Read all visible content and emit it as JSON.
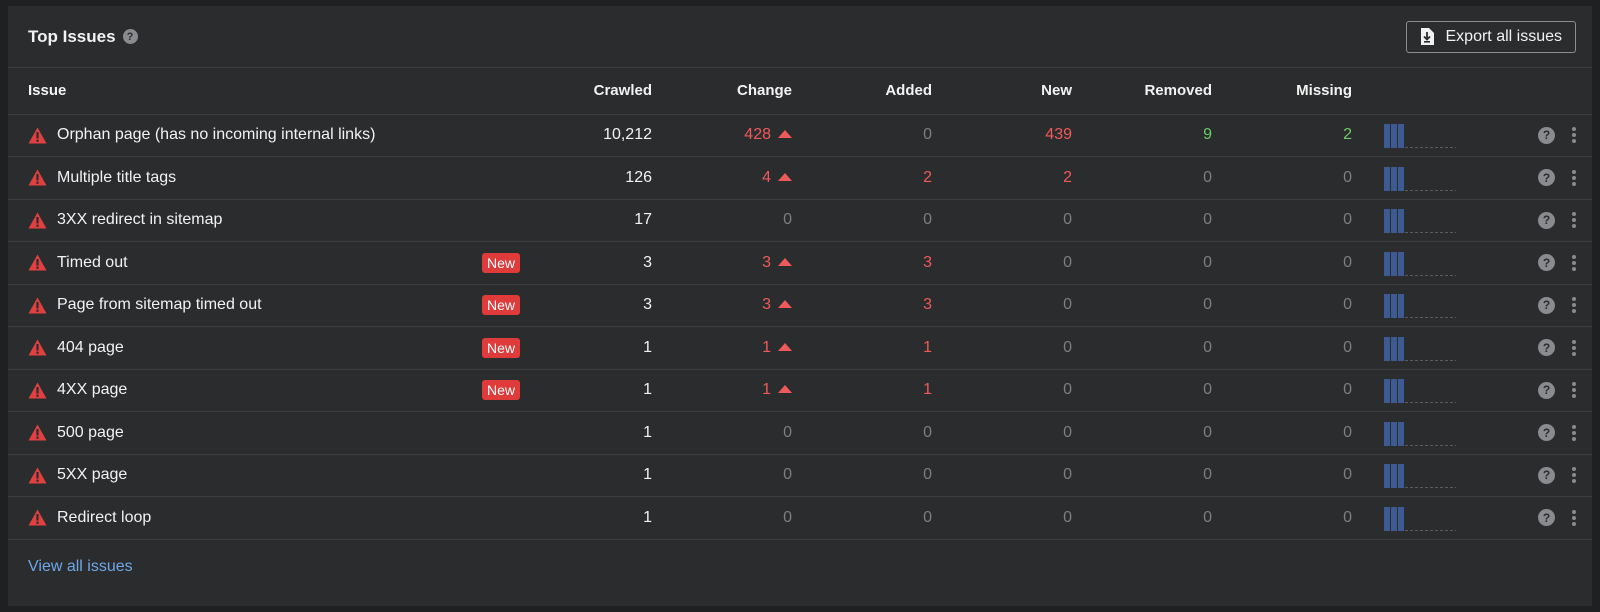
{
  "header": {
    "title": "Top Issues",
    "help_glyph": "?",
    "export_label": "Export all issues"
  },
  "columns": {
    "issue": "Issue",
    "crawled": "Crawled",
    "change": "Change",
    "added": "Added",
    "new": "New",
    "removed": "Removed",
    "missing": "Missing"
  },
  "rows": [
    {
      "name": "Orphan page (has no incoming internal links)",
      "badge": "",
      "crawled": "10,212",
      "change": "428",
      "change_up": true,
      "added": "0",
      "new": "439",
      "removed": "9",
      "missing": "2"
    },
    {
      "name": "Multiple title tags",
      "badge": "",
      "crawled": "126",
      "change": "4",
      "change_up": true,
      "added": "2",
      "new": "2",
      "removed": "0",
      "missing": "0"
    },
    {
      "name": "3XX redirect in sitemap",
      "badge": "",
      "crawled": "17",
      "change": "0",
      "change_up": false,
      "added": "0",
      "new": "0",
      "removed": "0",
      "missing": "0"
    },
    {
      "name": "Timed out",
      "badge": "New",
      "crawled": "3",
      "change": "3",
      "change_up": true,
      "added": "3",
      "new": "0",
      "removed": "0",
      "missing": "0"
    },
    {
      "name": "Page from sitemap timed out",
      "badge": "New",
      "crawled": "3",
      "change": "3",
      "change_up": true,
      "added": "3",
      "new": "0",
      "removed": "0",
      "missing": "0"
    },
    {
      "name": "404 page",
      "badge": "New",
      "crawled": "1",
      "change": "1",
      "change_up": true,
      "added": "1",
      "new": "0",
      "removed": "0",
      "missing": "0"
    },
    {
      "name": "4XX page",
      "badge": "New",
      "crawled": "1",
      "change": "1",
      "change_up": true,
      "added": "1",
      "new": "0",
      "removed": "0",
      "missing": "0"
    },
    {
      "name": "500 page",
      "badge": "",
      "crawled": "1",
      "change": "0",
      "change_up": false,
      "added": "0",
      "new": "0",
      "removed": "0",
      "missing": "0"
    },
    {
      "name": "5XX page",
      "badge": "",
      "crawled": "1",
      "change": "0",
      "change_up": false,
      "added": "0",
      "new": "0",
      "removed": "0",
      "missing": "0"
    },
    {
      "name": "Redirect loop",
      "badge": "",
      "crawled": "1",
      "change": "0",
      "change_up": false,
      "added": "0",
      "new": "0",
      "removed": "0",
      "missing": "0"
    }
  ],
  "icons": {
    "warning": "warning-icon",
    "export": "download-icon",
    "help": "help-icon",
    "menu": "more-vertical-icon",
    "trend": "sparkline-icon"
  },
  "colors": {
    "accent_link": "#6ea7e8",
    "negative": "#ee5a5a",
    "positive": "#69cc69",
    "badge": "#e03b3b",
    "sparkline": "#3d5a93"
  },
  "footer": {
    "view_all": "View all issues"
  }
}
